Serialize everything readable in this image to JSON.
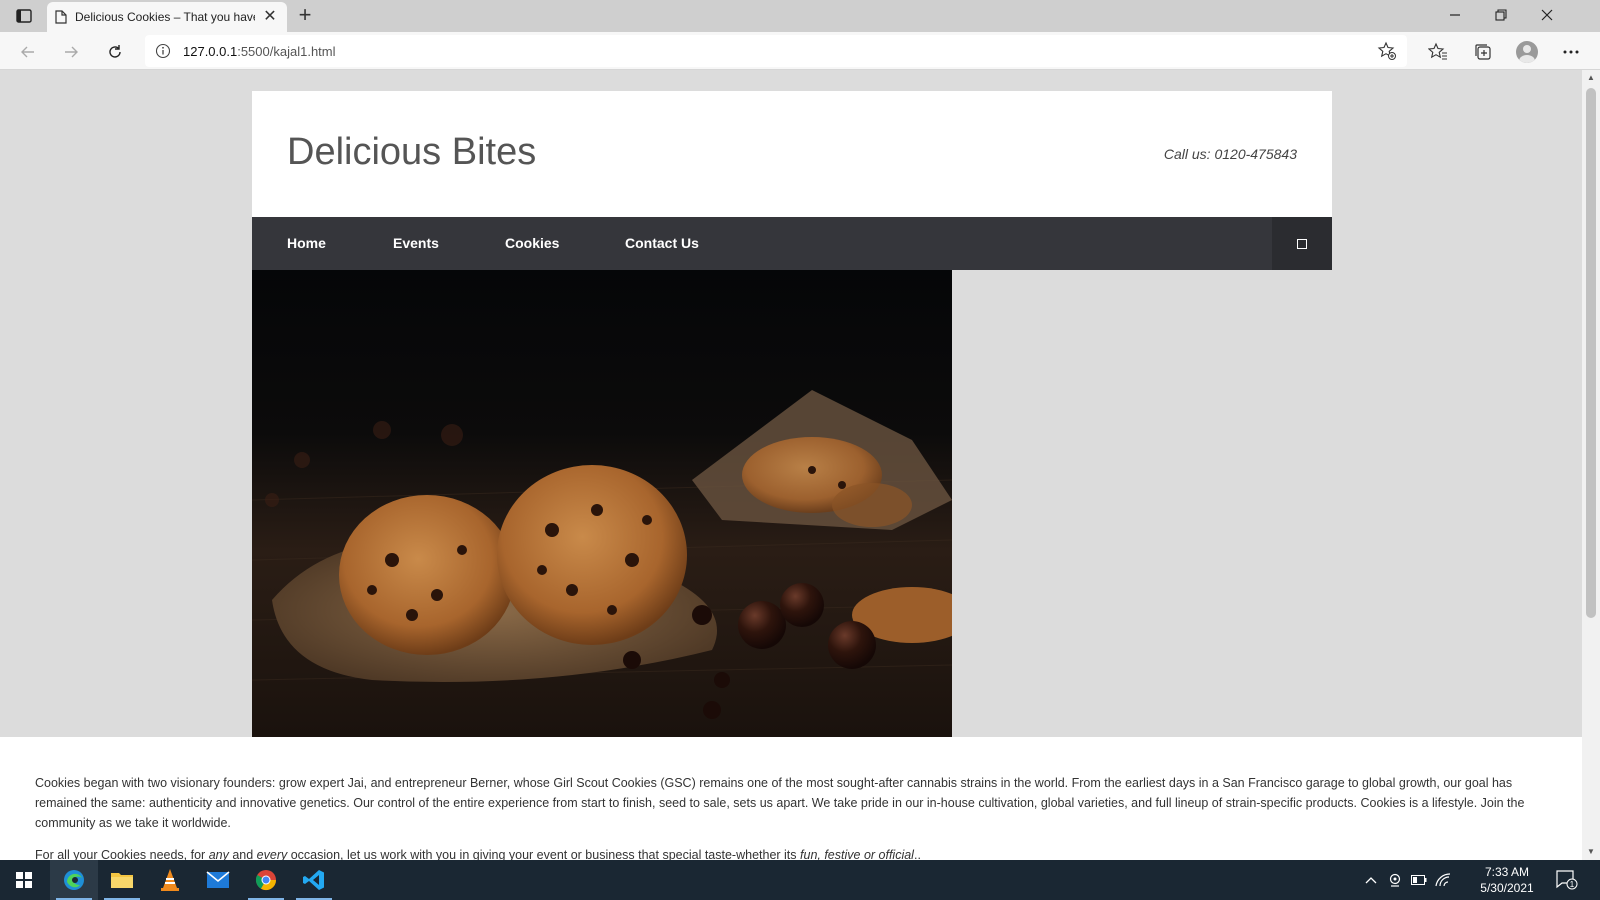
{
  "browser": {
    "tab_title": "Delicious Cookies – That you have",
    "url_host": "127.0.0.1",
    "url_path": ":5500/kajal1.html"
  },
  "site": {
    "title": "Delicious Bites",
    "phone": "Call us: 0120-475843",
    "nav": [
      "Home",
      "Events",
      "Cookies",
      "Contact Us"
    ]
  },
  "content": {
    "p1": "Cookies began with two visionary founders: grow expert Jai, and entrepreneur Berner, whose Girl Scout Cookies (GSC) remains one of the most sought-after cannabis strains in the world. From the earliest days in a San Francisco garage to global growth, our goal has remained the same: authenticity and innovative genetics. Our control of the entire experience from start to finish, seed to sale, sets us apart. We take pride in our in-house cultivation, global varieties, and full lineup of strain-specific products. Cookies is a lifestyle. Join the community as we take it worldwide.",
    "p2_a": "For all your Cookies needs, for ",
    "p2_b": "any",
    "p2_c": " and ",
    "p2_d": "every",
    "p2_e": " occasion, let us work with you in giving your event or business that special taste-whether its ",
    "p2_f": "fun, festive or official",
    "p2_g": ".."
  },
  "taskbar": {
    "apps": [
      "start",
      "edge",
      "file-explorer",
      "vlc",
      "mail",
      "chrome",
      "vscode"
    ],
    "time": "7:33 AM",
    "date": "5/30/2021",
    "notifications": "1"
  }
}
